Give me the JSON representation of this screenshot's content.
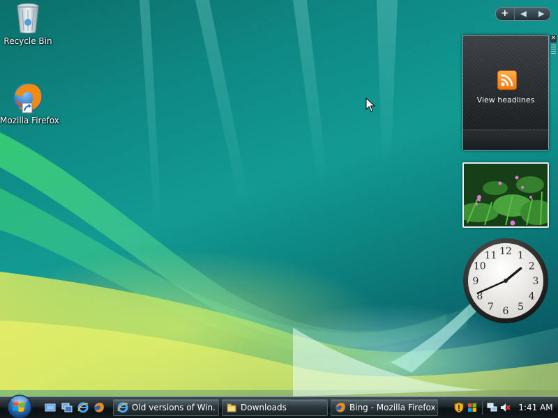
{
  "desktop": {
    "icons": [
      {
        "label": "Recycle Bin",
        "icon": "recycle-bin-icon"
      },
      {
        "label": "Mozilla Firefox",
        "icon": "firefox-icon"
      }
    ]
  },
  "gadget_toolbar": {
    "add_label": "+",
    "prev_label": "◀",
    "next_label": "▶"
  },
  "gadgets": {
    "feed": {
      "headline": "View headlines",
      "icon": "rss-icon"
    },
    "close_label": "✕",
    "slideshow": {
      "icon": "flowers-photo"
    },
    "clock": {
      "numbers": [
        "12",
        "1",
        "2",
        "3",
        "4",
        "5",
        "6",
        "7",
        "8",
        "9",
        "10",
        "11"
      ],
      "time": {
        "hour": 1,
        "minute": 41
      }
    }
  },
  "taskbar": {
    "start_icon": "windows-orb-icon",
    "quick_launch": [
      {
        "icon": "show-desktop-icon"
      },
      {
        "icon": "switch-windows-icon"
      },
      {
        "icon": "internet-explorer-icon"
      },
      {
        "icon": "firefox-icon"
      }
    ],
    "tasks": [
      {
        "label": "Old versions of Win...",
        "icon": "internet-explorer-icon"
      },
      {
        "label": "Downloads",
        "icon": "folder-icon"
      },
      {
        "label": "Bing - Mozilla Firefox",
        "icon": "firefox-icon"
      }
    ],
    "tray": {
      "icons": [
        "security-shield-icon",
        "windows-flag-icon",
        "network-icon",
        "volume-muted-icon"
      ],
      "clock": "1:41 AM"
    }
  },
  "colors": {
    "accent": "#f07a0c",
    "taskbar": "#111a1e"
  }
}
